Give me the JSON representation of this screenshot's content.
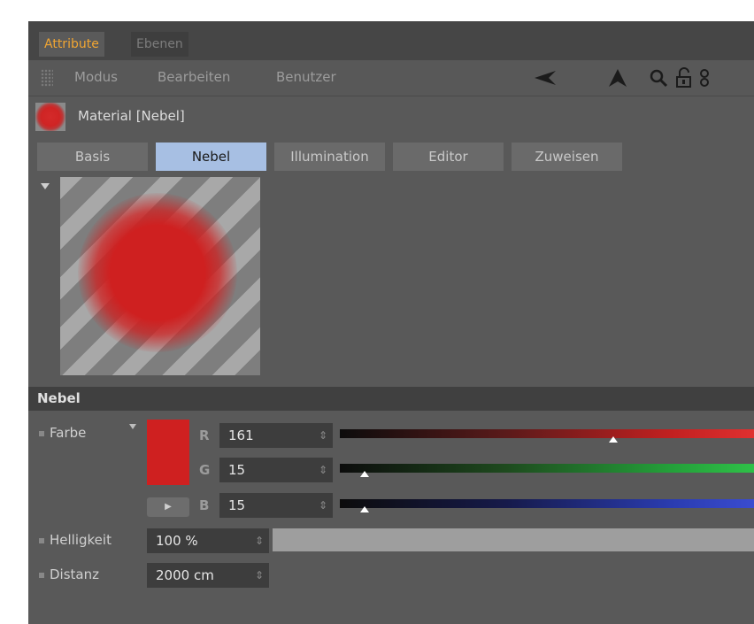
{
  "tabs": [
    {
      "label": "Attribute",
      "active": true
    },
    {
      "label": "Ebenen",
      "active": false
    }
  ],
  "menu": [
    "Modus",
    "Bearbeiten",
    "Benutzer"
  ],
  "toolbar_icons": [
    "back-arrow-icon",
    "up-arrow-icon",
    "search-icon",
    "lock-icon",
    "link-icon"
  ],
  "material": {
    "title": "Material [Nebel]"
  },
  "subtabs": [
    {
      "label": "Basis",
      "active": false
    },
    {
      "label": "Nebel",
      "active": true
    },
    {
      "label": "Illumination",
      "active": false
    },
    {
      "label": "Editor",
      "active": false
    },
    {
      "label": "Zuweisen",
      "active": false
    }
  ],
  "section": {
    "title": "Nebel"
  },
  "farbe": {
    "label": "Farbe",
    "swatch_color": "#cf2020",
    "r": {
      "label": "R",
      "value": "161",
      "fraction": 0.66
    },
    "g": {
      "label": "G",
      "value": "15",
      "fraction": 0.06
    },
    "b": {
      "label": "B",
      "value": "15",
      "fraction": 0.06
    }
  },
  "helligkeit": {
    "label": "Helligkeit",
    "value": "100 %"
  },
  "distanz": {
    "label": "Distanz",
    "value": "2000 cm"
  },
  "colors": {
    "accent_tab": "#f0a532",
    "active_subtab": "#a7bfe3"
  }
}
